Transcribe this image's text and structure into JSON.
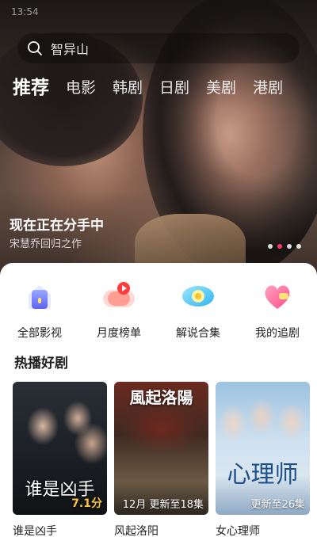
{
  "status_bar": {
    "time": "13:54"
  },
  "search": {
    "placeholder": "智异山"
  },
  "tabs": [
    {
      "label": "推荐",
      "active": true
    },
    {
      "label": "电影"
    },
    {
      "label": "韩剧"
    },
    {
      "label": "日剧"
    },
    {
      "label": "美剧"
    },
    {
      "label": "港剧"
    }
  ],
  "hero": {
    "title": "现在正在分手中",
    "subtitle": "宋慧乔回归之作",
    "slide_count": 4,
    "active_slide": 2
  },
  "quick_links": [
    {
      "label": "全部影视",
      "icon": "film-library-icon"
    },
    {
      "label": "月度榜单",
      "icon": "monthly-chart-icon"
    },
    {
      "label": "解说合集",
      "icon": "commentary-eye-icon"
    },
    {
      "label": "我的追剧",
      "icon": "heart-follow-icon"
    }
  ],
  "section": {
    "title": "热播好剧"
  },
  "shows": [
    {
      "name": "谁是凶手",
      "poster_text": "谁是凶手",
      "badge": "7.1分",
      "badge_type": "score"
    },
    {
      "name": "风起洛阳",
      "poster_text": "風起洛陽",
      "badge": "12月 更新至18集",
      "badge_type": "episodes"
    },
    {
      "name": "女心理师",
      "poster_text": "心理师",
      "badge": "更新至26集",
      "badge_type": "episodes"
    }
  ],
  "colors": {
    "accent": "#ff3a6a",
    "score": "#f7c33b"
  }
}
